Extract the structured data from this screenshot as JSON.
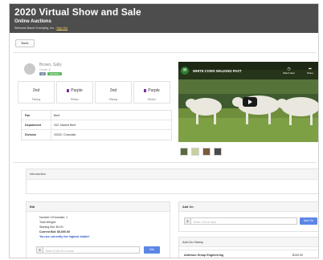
{
  "header": {
    "title": "2020 Virtual Show and Sale",
    "subtitle": "Online Auctions",
    "welcome": "Welcome Baudt Surveying, Inc - ",
    "sign_out": "Sign Out"
  },
  "back_label": "Back",
  "profile": {
    "name": "Brown, Sally",
    "class_line": "Grade: 8",
    "badge_a": "14",
    "badge_b": "Exhibitor"
  },
  "placings": [
    {
      "value": "2nd",
      "label": "Placing"
    },
    {
      "value": "Purple",
      "label": "Ribbon"
    },
    {
      "value": "2nd",
      "label": "Placing"
    },
    {
      "value": "Purple",
      "label": "Ribbon"
    }
  ],
  "details": [
    {
      "key": "Fair",
      "value": "Beef"
    },
    {
      "key": "Department",
      "value": "202: Market Beef"
    },
    {
      "key": "Division",
      "value": "20202: Charolais"
    }
  ],
  "video": {
    "title": "WHITE COWS WALKING PAST",
    "watch_later": "Watch later",
    "share": "Share"
  },
  "introduction": {
    "heading": "Introduction"
  },
  "bid": {
    "heading": "Bid",
    "animals": "Number Of Animals: 1",
    "weight": "Total Weight:",
    "starting": "Starting Bid: $0.00",
    "current": "Current Bid: $5,000.00",
    "highest": "You are currently the highest bidder!",
    "placeholder": "Enter 5,001.00 or more",
    "button": "Bid",
    "currency": "$"
  },
  "addon": {
    "heading": "Add On",
    "placeholder": "Enter 1.00 or more",
    "button": "Add On",
    "currency": "$"
  },
  "history": {
    "heading": "Add-On History",
    "rows": [
      {
        "name": "Alderson Group Engineering",
        "amount": "$100.00"
      }
    ]
  },
  "colors": {
    "header_bg": "#4d4d4d",
    "accent_blue": "#5b86e5",
    "ribbon_purple": "#7b2f9e",
    "badge_green": "#5cb85c"
  }
}
